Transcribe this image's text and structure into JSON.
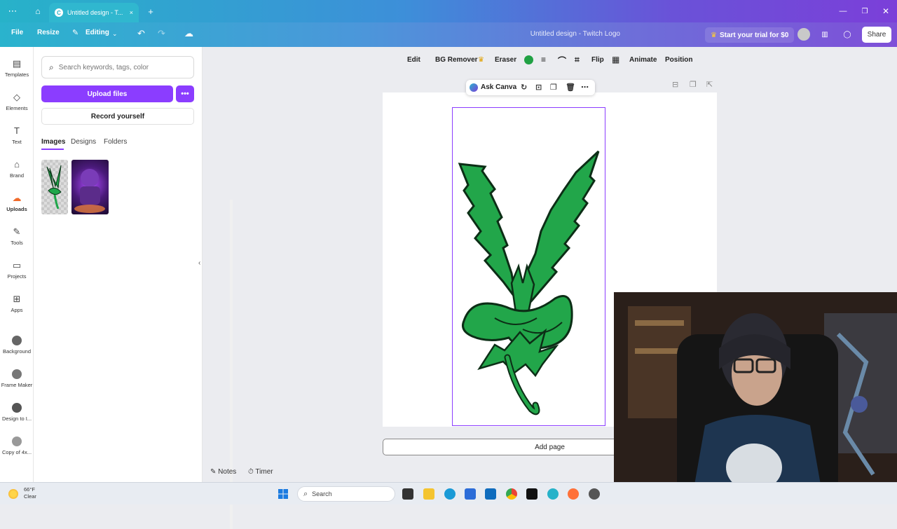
{
  "browser": {
    "tab_title": "Untitled design - T...",
    "new_tab_symbol": "+",
    "close_symbol": "×"
  },
  "topbar": {
    "file": "File",
    "resize": "Resize",
    "editing": "Editing",
    "design_title": "Untitled design - Twitch Logo",
    "trial_button": "Start your trial for $0",
    "share_button": "Share"
  },
  "rail": {
    "items": [
      {
        "label": "Templates",
        "icon": "templates-icon"
      },
      {
        "label": "Elements",
        "icon": "elements-icon"
      },
      {
        "label": "Text",
        "icon": "text-icon"
      },
      {
        "label": "Brand",
        "icon": "brand-icon"
      },
      {
        "label": "Uploads",
        "icon": "uploads-icon"
      },
      {
        "label": "Tools",
        "icon": "tools-icon"
      },
      {
        "label": "Projects",
        "icon": "projects-icon"
      },
      {
        "label": "Apps",
        "icon": "apps-icon"
      },
      {
        "label": "Background",
        "icon": "background-icon"
      },
      {
        "label": "Frame Maker",
        "icon": "frame-maker-icon"
      },
      {
        "label": "Design to I...",
        "icon": "design-to-icon"
      },
      {
        "label": "Copy of 4x...",
        "icon": "copy-icon"
      }
    ]
  },
  "panel": {
    "search_placeholder": "Search keywords, tags, color",
    "upload_button": "Upload files",
    "more_symbol": "•••",
    "record_button": "Record yourself",
    "tabs": [
      "Images",
      "Designs",
      "Folders"
    ]
  },
  "context_toolbar": {
    "edit": "Edit",
    "bg_remover": "BG Remover",
    "eraser": "Eraser",
    "color": "#21a144",
    "flip": "Flip",
    "animate": "Animate",
    "position": "Position"
  },
  "floating_toolbar": {
    "ask_canva": "Ask Canva"
  },
  "canvas": {
    "add_page": "Add page"
  },
  "bottom": {
    "notes": "Notes",
    "timer": "Timer"
  },
  "taskbar": {
    "temperature": "66°F",
    "condition": "Clear",
    "search": "Search"
  }
}
